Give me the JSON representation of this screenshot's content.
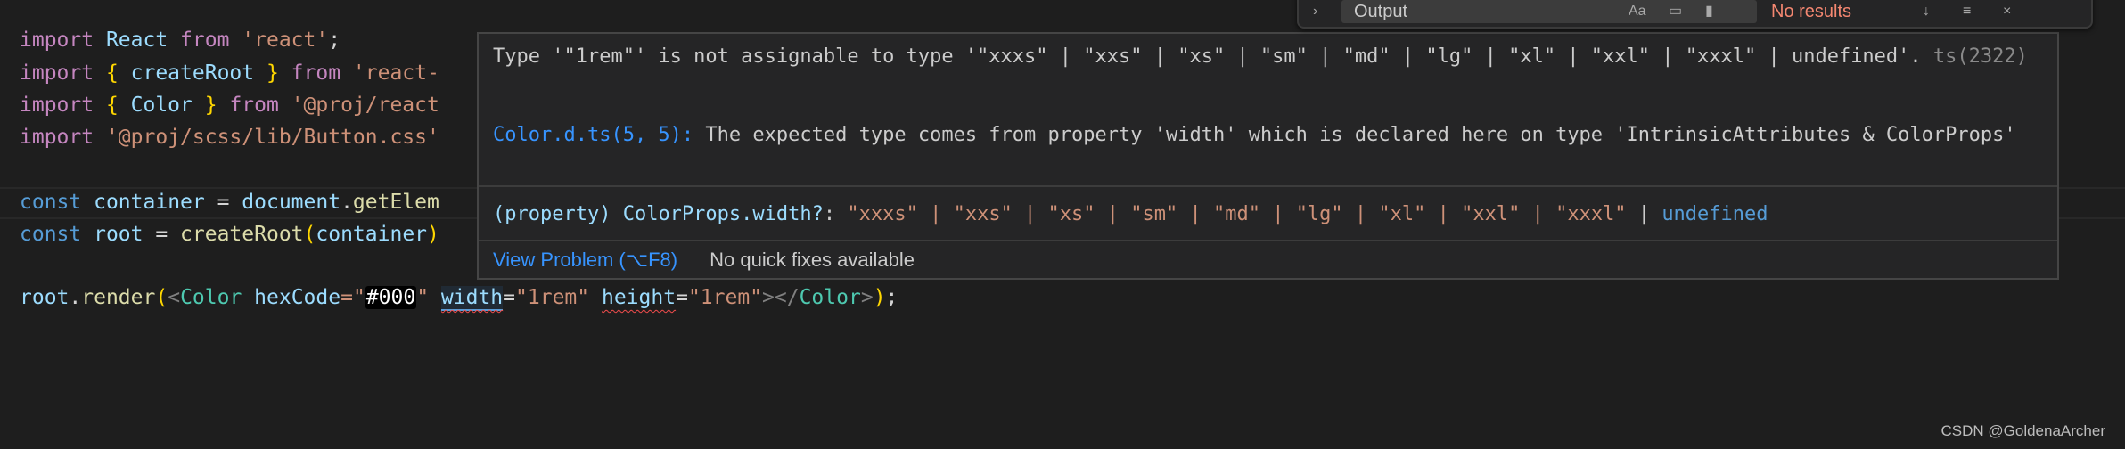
{
  "editor": {
    "lines": [
      {
        "t1": "import",
        "t2": " React ",
        "t3": "from",
        "t4": " ",
        "t5": "'react'",
        "t6": ";"
      },
      {
        "t1": "import",
        "t2": " { ",
        "t3": "createRoot",
        "t4": " } ",
        "t5": "from",
        "t6": " ",
        "t7": "'react-"
      },
      {
        "t1": "import",
        "t2": " { ",
        "t3": "Color",
        "t4": " } ",
        "t5": "from",
        "t6": " ",
        "t7": "'@proj/react"
      },
      {
        "t1": "import",
        "t2": " ",
        "t3": "'@proj/scss/lib/Button.css'"
      },
      {
        "t1": "const",
        "t2": " ",
        "t3": "container",
        "t4": " = ",
        "t5": "document",
        "t6": ".",
        "t7": "getElem"
      },
      {
        "t1": "const",
        "t2": " ",
        "t3": "root",
        "t4": " = ",
        "t5": "createRoot",
        "t6": "(",
        "t7": "container",
        "t8": ")"
      },
      {
        "t1": "root",
        "t2": ".",
        "t3": "render",
        "t4": "(",
        "t5": "<",
        "t6": "Color",
        "t7": " ",
        "t8": "hexCode",
        "t9": "=\"",
        "t10": "#000",
        "t11": "\"",
        "t12": " ",
        "t13": "width",
        "t14": "=",
        "t15": "\"1rem\"",
        "t16": " ",
        "t17": "height",
        "t18": "=",
        "t19": "\"1rem\"",
        "t20": "></",
        "t21": "Color",
        "t22": ">",
        "t23": ")",
        "t24": ";"
      }
    ]
  },
  "hover": {
    "error_message": "Type '\"1rem\"' is not assignable to type '\"xxxs\" | \"xxs\" | \"xs\" | \"sm\" | \"md\" | \"lg\" | \"xl\" | \"xxl\" | \"xxxl\" | undefined'.",
    "error_code": "ts(2322)",
    "related_location": "Color.d.ts(5, 5):",
    "related_message": "The expected type comes from property 'width' which is declared here on type 'IntrinsicAttributes & ColorProps'",
    "signature_prefix": "(property) ",
    "signature_name": "ColorProps.width?",
    "signature_colon": ": ",
    "signature_types": "\"xxxs\" | \"xxs\" | \"xs\" | \"sm\" | \"md\" | \"lg\" | \"xl\" | \"xxl\" | \"xxxl\"",
    "signature_sep": " | ",
    "signature_undefined": "undefined",
    "view_problem": "View Problem (⌥F8)",
    "no_quick_fixes": "No quick fixes available"
  },
  "find_widget": {
    "input_value": "Output",
    "match_case": "Aa",
    "status": "No results"
  },
  "watermark": "CSDN @GoldenaArcher",
  "colors": {
    "background": "#1e1e1e",
    "keyword": "#c586c0",
    "string": "#ce9178",
    "component": "#4ec9b0",
    "link": "#3794ff",
    "error": "#f14c4c"
  }
}
